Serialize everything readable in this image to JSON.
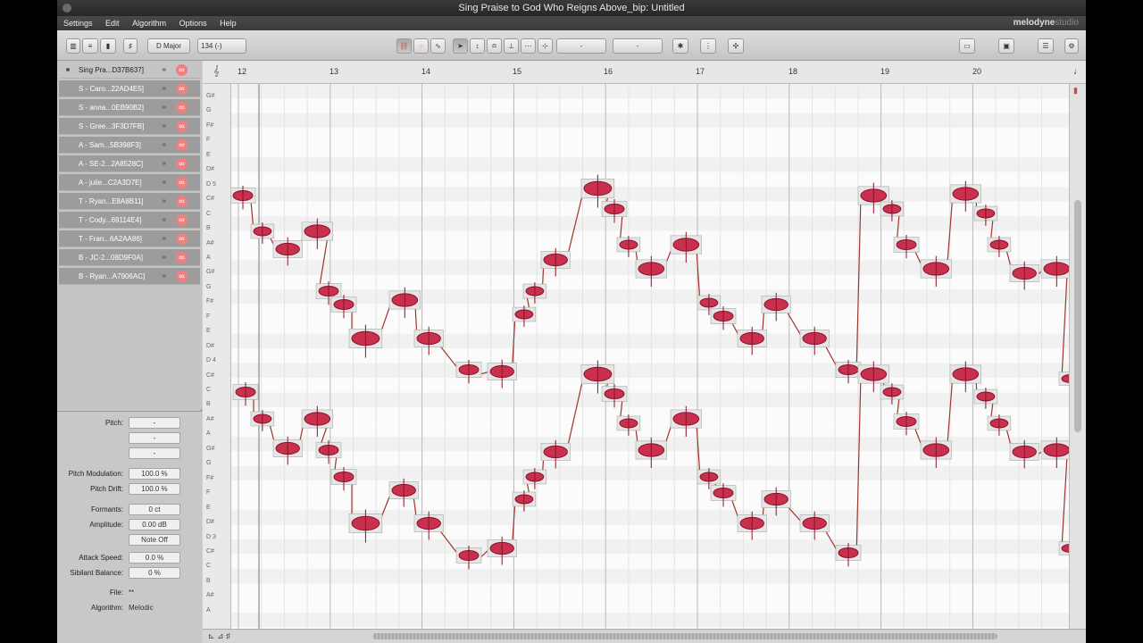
{
  "window": {
    "title": "Sing Praise to God Who Reigns Above_bip: Untitled"
  },
  "menu": {
    "items": [
      "Settings",
      "Edit",
      "Algorithm",
      "Options",
      "Help"
    ],
    "logo": "melodyne",
    "logo_suffix": "studio"
  },
  "toolbar": {
    "key": "D Major",
    "tempo": "134 (-)",
    "field_a": "-",
    "field_b": "-"
  },
  "tracks": [
    {
      "name": "Sing Pra...D37B637]",
      "active": true
    },
    {
      "name": "S - Caro...22AD4E5]"
    },
    {
      "name": "S - anna...0EB90B2]"
    },
    {
      "name": "S - Gree...3F3D7FB]"
    },
    {
      "name": "A - Sam...5B398F3]"
    },
    {
      "name": "A - SE-2...2A8528C]"
    },
    {
      "name": "A - julie...C2A3D7E]"
    },
    {
      "name": "T - Ryan...E8A8B11]"
    },
    {
      "name": "T - Cody...69114E4]"
    },
    {
      "name": "T - Fran...6A2AA86]"
    },
    {
      "name": "B - JC-2...08D9F0A]"
    },
    {
      "name": "B - Ryan...A7906AC]"
    }
  ],
  "inspector": {
    "pitch_label": "Pitch:",
    "pitch_value": "-",
    "pitch_value2": "-",
    "pitch_value3": "-",
    "pitch_mod_label": "Pitch Modulation:",
    "pitch_mod_value": "100.0 %",
    "pitch_drift_label": "Pitch Drift:",
    "pitch_drift_value": "100.0 %",
    "formants_label": "Formants:",
    "formants_value": "0 ct",
    "amplitude_label": "Amplitude:",
    "amplitude_value": "0.00 dB",
    "note_off": "Note Off",
    "attack_label": "Attack Speed:",
    "attack_value": "0.0 %",
    "sibilant_label": "Sibilant Balance:",
    "sibilant_value": "0 %",
    "file_label": "File:",
    "file_value": "**",
    "algorithm_label": "Algorithm:",
    "algorithm_value": "Melodic"
  },
  "ruler": {
    "bars": [
      "12",
      "13",
      "14",
      "15",
      "16",
      "17",
      "18",
      "19",
      "20"
    ]
  },
  "keys": [
    "G#",
    "G",
    "F#",
    "F",
    "E",
    "D#",
    "D 5",
    "C#",
    "C",
    "B",
    "A#",
    "A",
    "G#",
    "G",
    "F#",
    "F",
    "E",
    "D#",
    "D 4",
    "C#",
    "C",
    "B",
    "A#",
    "A",
    "G#",
    "G",
    "F#",
    "F",
    "E",
    "D#",
    "D 3",
    "C#",
    "C",
    "B",
    "A#",
    "A"
  ],
  "colors": {
    "blob": "#c8304e",
    "blob_dark": "#8a1228",
    "pitch_line": "#a0342a",
    "link_icon": "#ef8080"
  }
}
